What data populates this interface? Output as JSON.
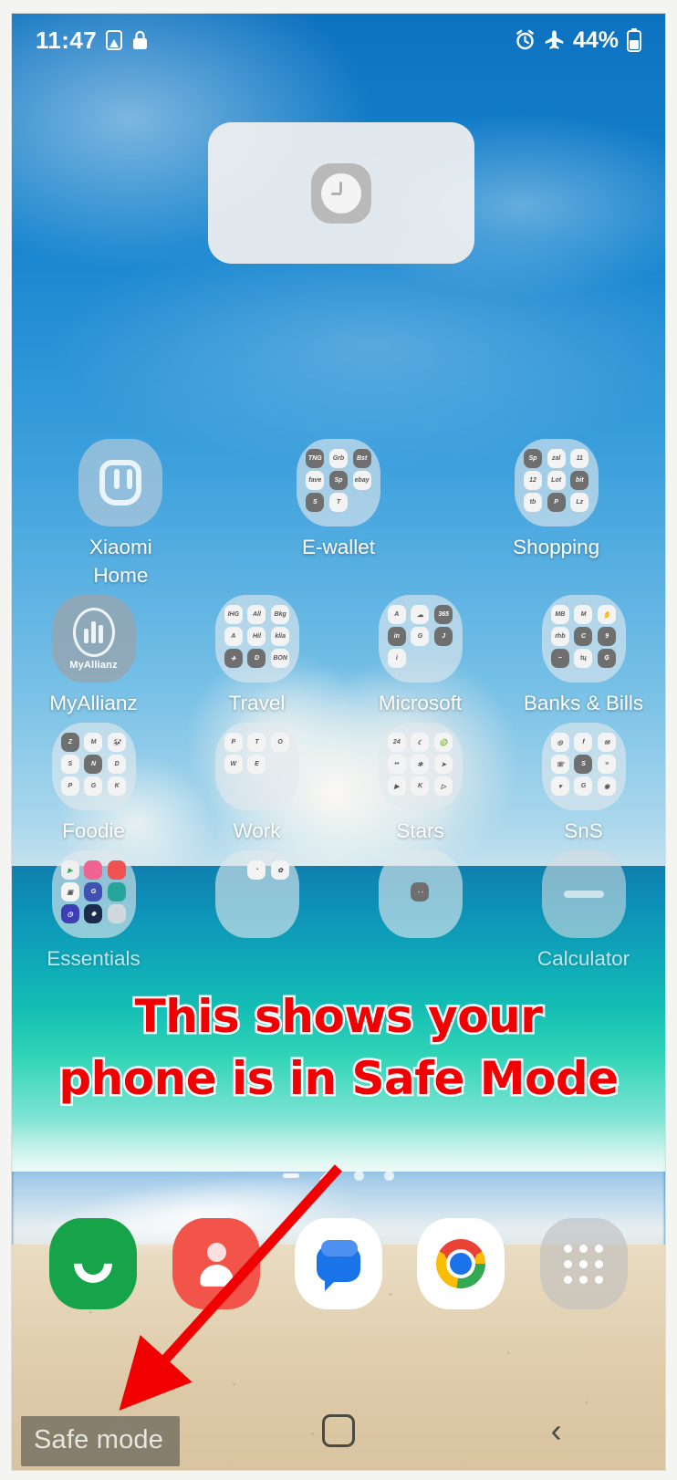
{
  "status_bar": {
    "time": "11:47",
    "battery_percent": "44%",
    "icons_left": [
      "sim-card-warning-icon",
      "lock-icon"
    ],
    "icons_right": [
      "alarm-icon",
      "airplane-mode-icon",
      "battery-icon"
    ]
  },
  "widget": {
    "name": "clock-widget",
    "icon": "clock-icon"
  },
  "home_screen": {
    "rows": [
      [
        {
          "label": "Xiaomi\nHome",
          "type": "app",
          "icon": "xiaomi-home-icon"
        },
        {
          "label": "E-wallet",
          "type": "folder",
          "items": [
            "TNG",
            "GrabPay",
            "Boost",
            "Fave",
            "ShopeePay",
            "eBay",
            "Setel",
            "Touch"
          ]
        },
        {
          "label": "Shopping",
          "type": "folder",
          "items": [
            "Shopee",
            "Zalora",
            "Lazada",
            "11street",
            "Lotus",
            "Bites",
            "Taobao",
            "PG Mall",
            "Lazada"
          ]
        }
      ],
      [
        {
          "label": "MyAllianz",
          "type": "app",
          "icon": "myallianz-icon"
        },
        {
          "label": "Travel",
          "type": "folder",
          "items": [
            "IHG",
            "AirAsia",
            "BookingCom",
            "Airbnb",
            "Hilton",
            "KLIA",
            "Agoda",
            "Disney",
            "Bonvoy"
          ]
        },
        {
          "label": "Microsoft",
          "type": "folder",
          "items": [
            "Authenticator",
            "OneDrive",
            "Office",
            "LinkedIn",
            "Copilot",
            "Journal",
            "Info"
          ]
        },
        {
          "label": "Banks & Bills",
          "type": "folder",
          "items": [
            "Maybank",
            "Maxis",
            "TNB",
            "RHB",
            "Touch n Go",
            "CIMB",
            "Boost",
            "Tune",
            "Payment"
          ]
        }
      ],
      [
        {
          "label": "Foodie",
          "type": "folder",
          "items": [
            "Zus",
            "McDonalds",
            "Panda",
            "Starbucks",
            "Nandos",
            "Domino",
            "Pickle",
            "Grab",
            "KFC"
          ]
        },
        {
          "label": "Work",
          "type": "folder",
          "items": [
            "PowerPoint",
            "Teams",
            "Outlook",
            "Word",
            "Edge"
          ]
        },
        {
          "label": "Stars",
          "type": "folder",
          "items": [
            "24h",
            "Moon",
            "Astro",
            "News",
            "Zodiac",
            "Telegram",
            "YouTube",
            "Mixer",
            "Player"
          ]
        },
        {
          "label": "SnS",
          "type": "folder",
          "items": [
            "Instagram",
            "Facebook",
            "Email",
            "WhatsApp",
            "Signal",
            "Notes",
            "Dropbox",
            "Google",
            "Messenger"
          ]
        }
      ],
      [
        {
          "label": "Essentials",
          "type": "folder",
          "items": [
            "Play Store",
            "Gallery",
            "Camera",
            "Notes",
            "Drive",
            "Calendar",
            "Clock",
            "Settings",
            "Weather"
          ]
        },
        {
          "label": "",
          "type": "folder",
          "items": [
            "Apps",
            "Tools"
          ]
        },
        {
          "label": "",
          "type": "folder",
          "items": [
            "Glasses"
          ]
        },
        {
          "label": "Calculator",
          "type": "app",
          "icon": "calculator-icon"
        }
      ]
    ]
  },
  "page_indicator": {
    "pages": [
      "apps-page",
      "home-page",
      "page-3",
      "page-4"
    ],
    "active_index": 1
  },
  "dock": {
    "items": [
      {
        "label": "Phone",
        "icon": "phone-icon"
      },
      {
        "label": "Contacts",
        "icon": "contacts-icon"
      },
      {
        "label": "Messages",
        "icon": "messages-icon"
      },
      {
        "label": "Chrome",
        "icon": "chrome-icon"
      },
      {
        "label": "Apps",
        "icon": "apps-grid-icon"
      }
    ]
  },
  "nav_bar": {
    "recents_label": "recents-button",
    "home_label": "home-button",
    "back_label": "back-button"
  },
  "safe_mode_badge": {
    "text": "Safe mode"
  },
  "annotation": {
    "text": "This shows your phone is in Safe Mode",
    "color": "#f00000",
    "arrow": "red-arrow-pointing-to-safe-mode-badge"
  }
}
